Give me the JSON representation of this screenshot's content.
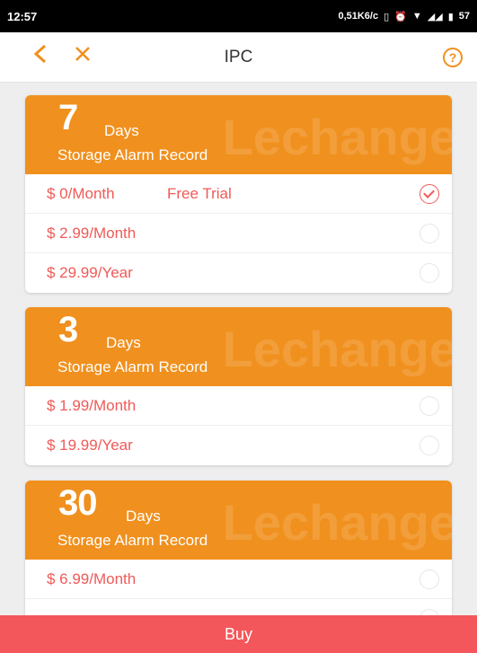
{
  "status_bar": {
    "time": "12:57",
    "speed": "0,51K6/c",
    "battery": "57"
  },
  "nav": {
    "title": "IPC",
    "help": "?"
  },
  "plans": [
    {
      "days_number": "7",
      "days_label": "Days",
      "storage_label": "Storage Alarm Record",
      "watermark": "Lechange",
      "options": [
        {
          "price": "$ 0/Month",
          "extra": "Free Trial",
          "selected": true
        },
        {
          "price": "$ 2.99/Month",
          "extra": "",
          "selected": false
        },
        {
          "price": "$ 29.99/Year",
          "extra": "",
          "selected": false
        }
      ]
    },
    {
      "days_number": "3",
      "days_label": "Days",
      "storage_label": "Storage Alarm Record",
      "watermark": "Lechange",
      "options": [
        {
          "price": "$ 1.99/Month",
          "extra": "",
          "selected": false
        },
        {
          "price": "$ 19.99/Year",
          "extra": "",
          "selected": false
        }
      ]
    },
    {
      "days_number": "30",
      "days_label": "Days",
      "storage_label": "Storage Alarm Record",
      "watermark": "Lechange",
      "options": [
        {
          "price": "$ 6.99/Month",
          "extra": "",
          "selected": false
        }
      ]
    }
  ],
  "buy_label": "Buy",
  "colors": {
    "accent": "#f0901e",
    "price": "#ef5a57",
    "buy": "#f4575b"
  }
}
